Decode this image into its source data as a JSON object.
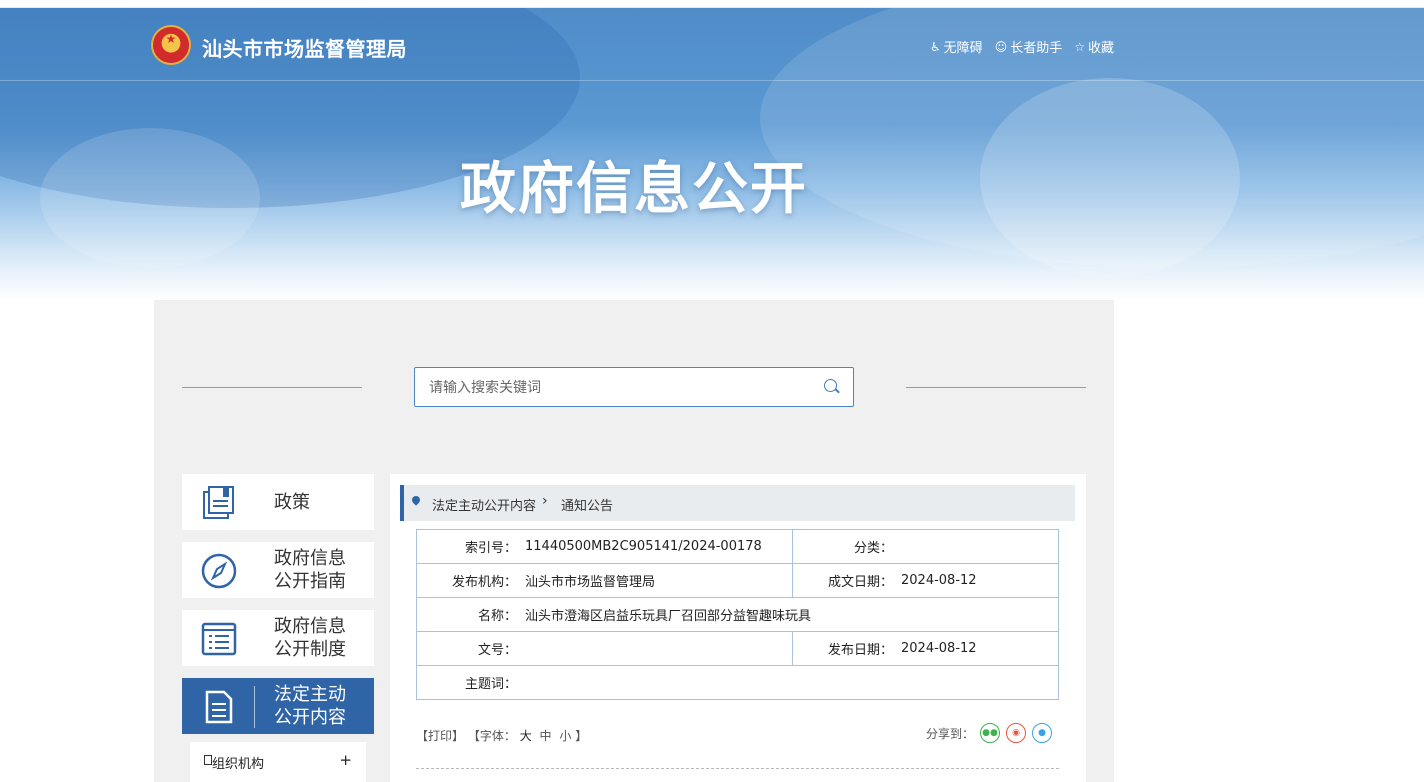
{
  "header": {
    "site_title": "汕头市市场监督管理局",
    "tools": [
      {
        "icon": "wheelchair-icon",
        "label": "无障碍"
      },
      {
        "icon": "elder-icon",
        "label": "长者助手"
      },
      {
        "icon": "star-icon",
        "label": "收藏"
      }
    ]
  },
  "banner": {
    "title": "政府信息公开"
  },
  "search": {
    "placeholder": "请输入搜索关键词"
  },
  "sidebar": {
    "items": [
      {
        "label": "政策",
        "icon": "policy-book-icon"
      },
      {
        "label": "政府信息\n公开指南",
        "icon": "compass-icon"
      },
      {
        "label": "政府信息\n公开制度",
        "icon": "list-book-icon"
      },
      {
        "label": "法定主动\n公开内容",
        "icon": "document-icon",
        "active": true
      }
    ],
    "sub_items": [
      {
        "label": "组织机构",
        "expand": "+"
      }
    ]
  },
  "breadcrumb": {
    "parent": "法定主动公开内容",
    "current": "通知公告"
  },
  "meta": {
    "index_label": "索引号：",
    "index_value": "11440500MB2C905141/2024-00178",
    "category_label": "分类：",
    "category_value": "",
    "publisher_label": "发布机构：",
    "publisher_value": "汕头市市场监督管理局",
    "created_label": "成文日期：",
    "created_value": "2024-08-12",
    "name_label": "名称：",
    "name_value": "汕头市澄海区启益乐玩具厂召回部分益智趣味玩具",
    "docno_label": "文号：",
    "docno_value": "",
    "pubdate_label": "发布日期：",
    "pubdate_value": "2024-08-12",
    "keywords_label": "主题词：",
    "keywords_value": ""
  },
  "article_tools": {
    "print": "【打印】",
    "font_open": "【字体：",
    "font_large": "大",
    "font_medium": "中",
    "font_small": "小",
    "font_close": "】",
    "share_label": "分享到："
  },
  "colors": {
    "primary": "#2f64a6",
    "wechat": "#3fb34f",
    "weibo": "#e8533e",
    "qq": "#3aa3e3"
  }
}
